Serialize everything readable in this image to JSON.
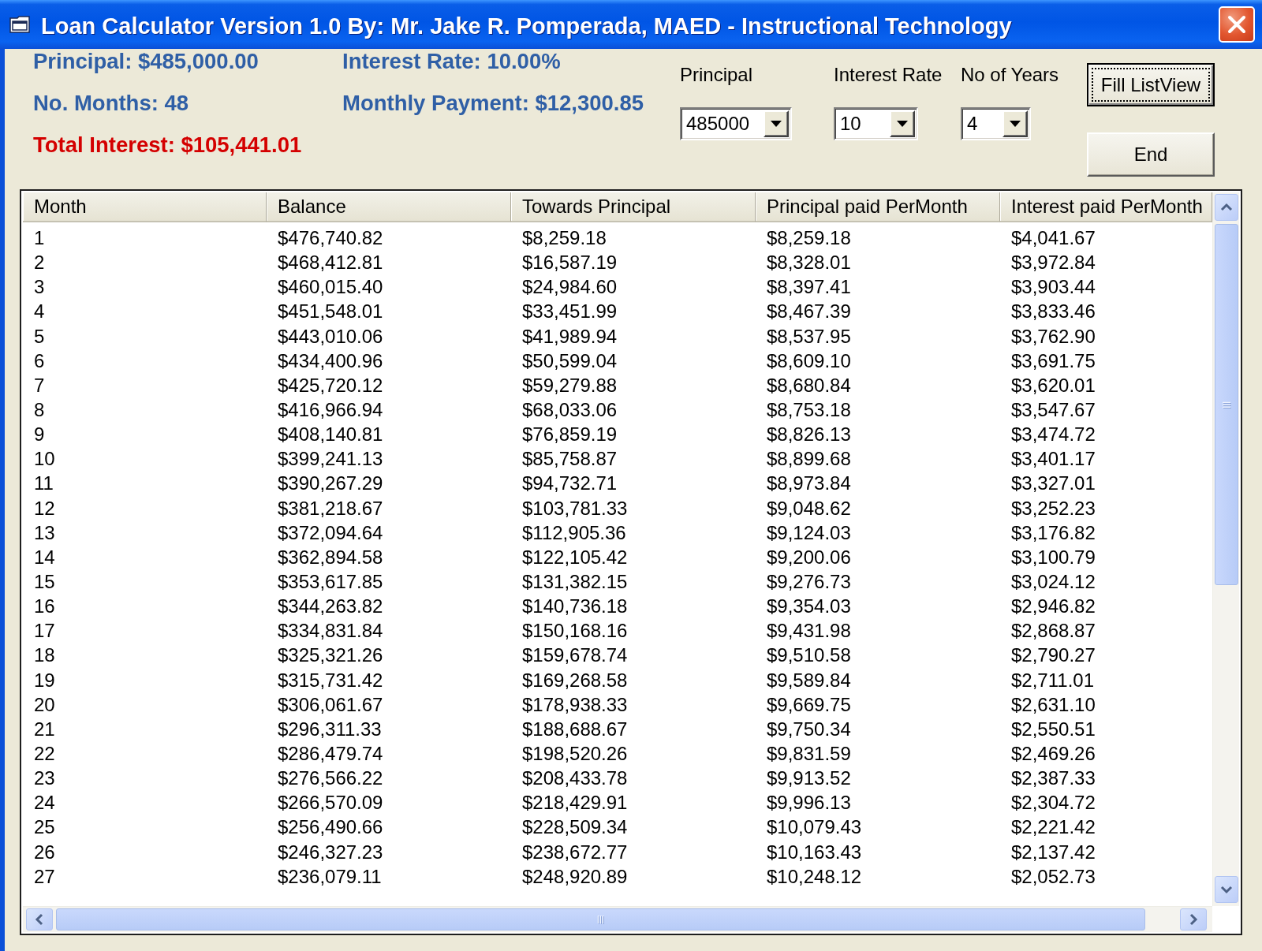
{
  "window": {
    "title": "Loan Calculator Version 1.0 By: Mr. Jake R. Pomperada, MAED - Instructional Technology"
  },
  "summary": [
    {
      "text": "Principal: $485,000.00",
      "kind": "info"
    },
    {
      "text": "Interest Rate: 10.00%",
      "kind": "info"
    },
    {
      "text": "No. Months: 48",
      "kind": "info"
    },
    {
      "text": "Monthly Payment: $12,300.85",
      "kind": "info"
    },
    {
      "text": "Total Interest: $105,441.01",
      "kind": "total"
    }
  ],
  "inputs": [
    {
      "label": "Principal",
      "value": "485000"
    },
    {
      "label": "Interest Rate",
      "value": "10"
    },
    {
      "label": "No of Years",
      "value": "4"
    }
  ],
  "buttons": [
    {
      "label": "Fill ListView",
      "focused": true
    },
    {
      "label": "End",
      "focused": false
    }
  ],
  "table": {
    "columns": [
      "Month",
      "Balance",
      "Towards Principal",
      "Principal paid PerMonth",
      "Interest paid PerMonth"
    ],
    "rows": [
      [
        "1",
        "$476,740.82",
        "$8,259.18",
        "$8,259.18",
        "$4,041.67"
      ],
      [
        "2",
        "$468,412.81",
        "$16,587.19",
        "$8,328.01",
        "$3,972.84"
      ],
      [
        "3",
        "$460,015.40",
        "$24,984.60",
        "$8,397.41",
        "$3,903.44"
      ],
      [
        "4",
        "$451,548.01",
        "$33,451.99",
        "$8,467.39",
        "$3,833.46"
      ],
      [
        "5",
        "$443,010.06",
        "$41,989.94",
        "$8,537.95",
        "$3,762.90"
      ],
      [
        "6",
        "$434,400.96",
        "$50,599.04",
        "$8,609.10",
        "$3,691.75"
      ],
      [
        "7",
        "$425,720.12",
        "$59,279.88",
        "$8,680.84",
        "$3,620.01"
      ],
      [
        "8",
        "$416,966.94",
        "$68,033.06",
        "$8,753.18",
        "$3,547.67"
      ],
      [
        "9",
        "$408,140.81",
        "$76,859.19",
        "$8,826.13",
        "$3,474.72"
      ],
      [
        "10",
        "$399,241.13",
        "$85,758.87",
        "$8,899.68",
        "$3,401.17"
      ],
      [
        "11",
        "$390,267.29",
        "$94,732.71",
        "$8,973.84",
        "$3,327.01"
      ],
      [
        "12",
        "$381,218.67",
        "$103,781.33",
        "$9,048.62",
        "$3,252.23"
      ],
      [
        "13",
        "$372,094.64",
        "$112,905.36",
        "$9,124.03",
        "$3,176.82"
      ],
      [
        "14",
        "$362,894.58",
        "$122,105.42",
        "$9,200.06",
        "$3,100.79"
      ],
      [
        "15",
        "$353,617.85",
        "$131,382.15",
        "$9,276.73",
        "$3,024.12"
      ],
      [
        "16",
        "$344,263.82",
        "$140,736.18",
        "$9,354.03",
        "$2,946.82"
      ],
      [
        "17",
        "$334,831.84",
        "$150,168.16",
        "$9,431.98",
        "$2,868.87"
      ],
      [
        "18",
        "$325,321.26",
        "$159,678.74",
        "$9,510.58",
        "$2,790.27"
      ],
      [
        "19",
        "$315,731.42",
        "$169,268.58",
        "$9,589.84",
        "$2,711.01"
      ],
      [
        "20",
        "$306,061.67",
        "$178,938.33",
        "$9,669.75",
        "$2,631.10"
      ],
      [
        "21",
        "$296,311.33",
        "$188,688.67",
        "$9,750.34",
        "$2,550.51"
      ],
      [
        "22",
        "$286,479.74",
        "$198,520.26",
        "$9,831.59",
        "$2,469.26"
      ],
      [
        "23",
        "$276,566.22",
        "$208,433.78",
        "$9,913.52",
        "$2,387.33"
      ],
      [
        "24",
        "$266,570.09",
        "$218,429.91",
        "$9,996.13",
        "$2,304.72"
      ],
      [
        "25",
        "$256,490.66",
        "$228,509.34",
        "$10,079.43",
        "$2,221.42"
      ],
      [
        "26",
        "$246,327.23",
        "$238,672.77",
        "$10,163.43",
        "$2,137.42"
      ],
      [
        "27",
        "$236,079.11",
        "$248,920.89",
        "$10,248.12",
        "$2,052.73"
      ]
    ]
  }
}
